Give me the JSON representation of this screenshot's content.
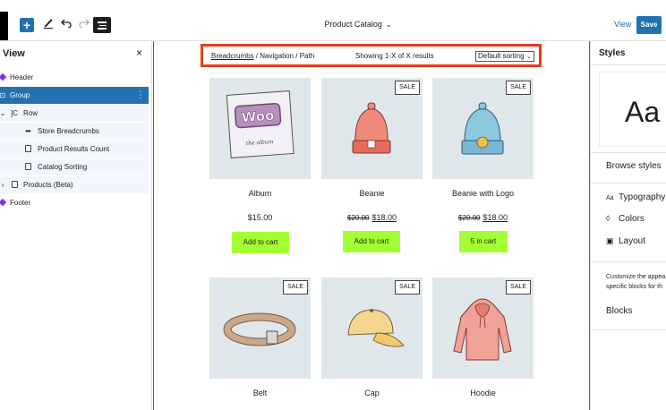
{
  "toolbar": {
    "add_label": "+",
    "doc_title": "Product Catalog",
    "view_label": "View",
    "save_label": "Save"
  },
  "list_view": {
    "title": "View",
    "close_glyph": "×",
    "items": [
      {
        "label": "Header",
        "icon": "template-part-icon"
      },
      {
        "label": "Group",
        "icon": "group-icon",
        "selected": true
      },
      {
        "label": "Row",
        "icon": "row-icon"
      },
      {
        "label": "Store Breadcrumbs",
        "icon": "breadcrumbs-icon"
      },
      {
        "label": "Product Results Count",
        "icon": "block-icon"
      },
      {
        "label": "Catalog Sorting",
        "icon": "block-icon"
      },
      {
        "label": "Products (Beta)",
        "icon": "query-icon"
      },
      {
        "label": "Footer",
        "icon": "template-part-icon"
      }
    ]
  },
  "store_bar": {
    "breadcrumb_link": "Breadcrumbs",
    "breadcrumb_rest": " / Navigation / Path",
    "results_text": "Showing 1-X of X results",
    "sorting_value": "Default sorting"
  },
  "products": [
    {
      "name": "Album",
      "price": "$15.00",
      "old_price": "",
      "sale": "",
      "button": "Add to cart"
    },
    {
      "name": "Beanie",
      "price": "$18.00",
      "old_price": "$20.00",
      "sale": "SALE",
      "button": "Add to cart"
    },
    {
      "name": "Beanie with Logo",
      "price": "$18.00",
      "old_price": "$20.00",
      "sale": "SALE",
      "button": "5 in cart"
    },
    {
      "name": "Belt",
      "price": "",
      "old_price": "",
      "sale": "SALE",
      "button": ""
    },
    {
      "name": "Cap",
      "price": "",
      "old_price": "",
      "sale": "SALE",
      "button": ""
    },
    {
      "name": "Hoodie",
      "price": "",
      "old_price": "",
      "sale": "SALE",
      "button": ""
    }
  ],
  "album_art": {
    "logo_text": "Woo",
    "caption": "the album"
  },
  "styles_panel": {
    "title": "Styles",
    "preview_text": "Aa",
    "browse_label": "Browse styles",
    "typography_label": "Typography",
    "typography_icon_text": "Aa",
    "colors_label": "Colors",
    "layout_label": "Layout",
    "desc_line1": "Customize the appea",
    "desc_line2": "specific blocks for th",
    "blocks_label": "Blocks"
  },
  "colors": {
    "accent": "#2271b1",
    "highlight_border": "#e2401c",
    "cart_button": "#a3ff33",
    "image_bg": "#dfe7ea"
  }
}
